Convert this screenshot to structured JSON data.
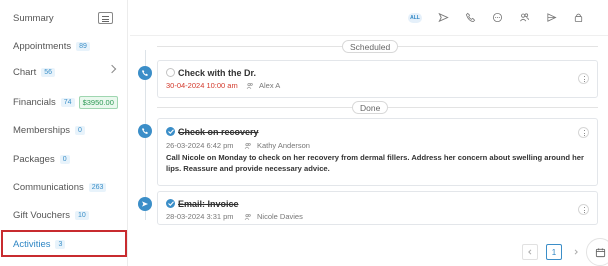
{
  "sidebar": {
    "items": [
      {
        "label": "Summary"
      },
      {
        "label": "Appointments",
        "badge": "89"
      },
      {
        "label": "Chart",
        "badge": "56"
      },
      {
        "label": "Financials",
        "badge": "74",
        "amount": "$3950.00"
      },
      {
        "label": "Memberships",
        "badge": "0"
      },
      {
        "label": "Packages",
        "badge": "0"
      },
      {
        "label": "Communications",
        "badge": "263"
      },
      {
        "label": "Gift Vouchers",
        "badge": "10"
      },
      {
        "label": "Activities",
        "badge": "3"
      }
    ],
    "active": "Activities"
  },
  "filters": {
    "all_label": "ALL",
    "icons": [
      "send-icon",
      "phone-icon",
      "chat-icon",
      "people-icon",
      "paper-plane-icon",
      "lock-icon"
    ]
  },
  "sections": {
    "scheduled": "Scheduled",
    "done": "Done"
  },
  "activities": [
    {
      "title": "Check with the Dr.",
      "datetime": "30-04-2024 10:00 am",
      "person": "Alex A",
      "status": "scheduled",
      "type": "phone-icon"
    },
    {
      "title": "Check on recovery",
      "datetime": "26-03-2024 6:42 pm",
      "person": "Kathy Anderson",
      "status": "done",
      "type": "phone-icon",
      "note": "Call Nicole on Monday to check on her recovery from dermal fillers. Address her concern about swelling around her lips. Reassure and provide necessary advice."
    },
    {
      "title": "Email: Invoice",
      "datetime": "28-03-2024 3:31 pm",
      "person": "Nicole Davies",
      "status": "done",
      "type": "send-icon"
    }
  ],
  "pagination": {
    "current": "1"
  },
  "colors": {
    "accent": "#3b8ec8",
    "overdue": "#d33a2c",
    "highlight": "#c82b2f",
    "money": "#2e9a55"
  }
}
